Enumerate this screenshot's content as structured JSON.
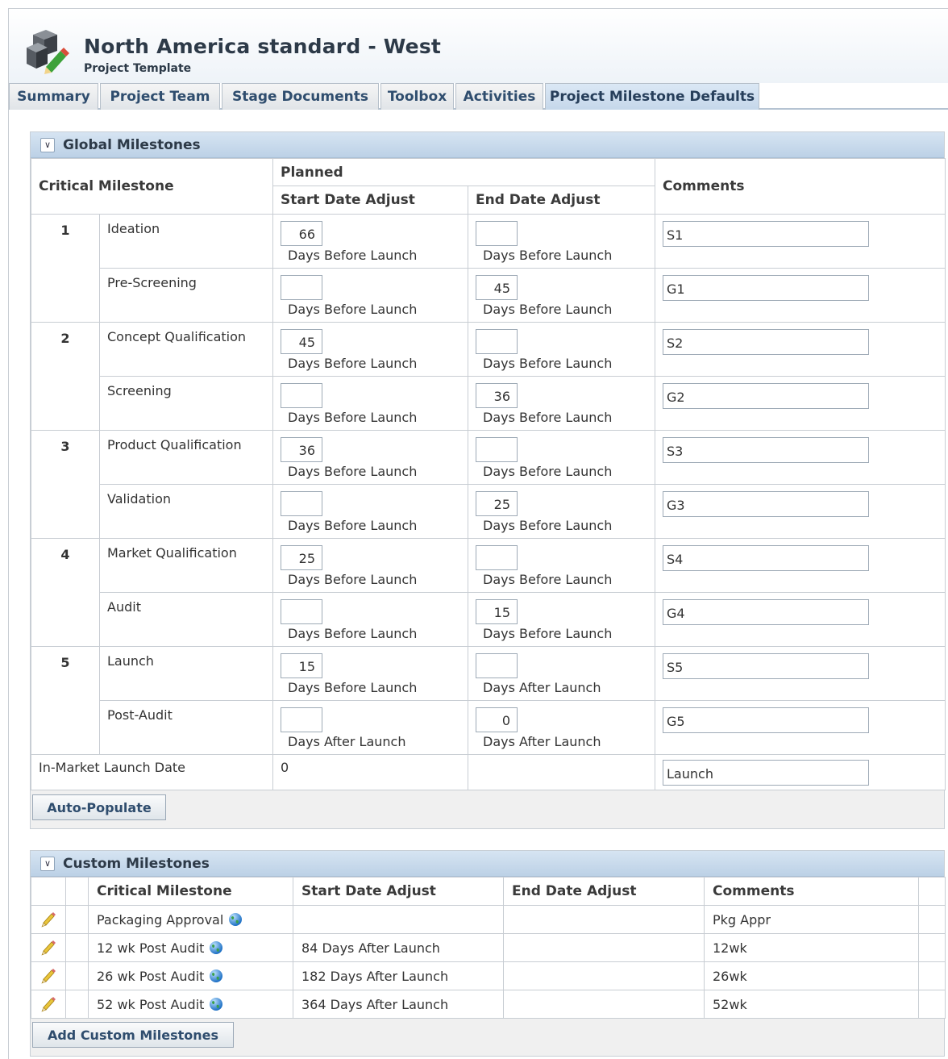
{
  "header": {
    "title": "North America standard - West",
    "subtitle": "Project Template"
  },
  "tabs": [
    {
      "label": "Summary",
      "active": false
    },
    {
      "label": "Project Team",
      "active": false
    },
    {
      "label": "Stage Documents",
      "active": false
    },
    {
      "label": "Toolbox",
      "active": false
    },
    {
      "label": "Activities",
      "active": false
    },
    {
      "label": "Project Milestone Defaults",
      "active": true
    }
  ],
  "global": {
    "title": "Global Milestones",
    "col_critical": "Critical Milestone",
    "col_planned": "Planned",
    "col_start": "Start Date Adjust",
    "col_end": "End Date Adjust",
    "col_comments": "Comments",
    "groups": [
      {
        "num": "1",
        "rows": [
          {
            "name": "Ideation",
            "start": "66",
            "start_unit": "Days Before Launch",
            "end": "",
            "end_unit": "Days Before Launch",
            "comment": "S1"
          },
          {
            "name": "Pre-Screening",
            "start": "",
            "start_unit": "Days Before Launch",
            "end": "45",
            "end_unit": "Days Before Launch",
            "comment": "G1"
          }
        ]
      },
      {
        "num": "2",
        "rows": [
          {
            "name": "Concept Qualification",
            "start": "45",
            "start_unit": "Days Before Launch",
            "end": "",
            "end_unit": "Days Before Launch",
            "comment": "S2"
          },
          {
            "name": "Screening",
            "start": "",
            "start_unit": "Days Before Launch",
            "end": "36",
            "end_unit": "Days Before Launch",
            "comment": "G2"
          }
        ]
      },
      {
        "num": "3",
        "rows": [
          {
            "name": "Product Qualification",
            "start": "36",
            "start_unit": "Days Before Launch",
            "end": "",
            "end_unit": "Days Before Launch",
            "comment": "S3"
          },
          {
            "name": "Validation",
            "start": "",
            "start_unit": "Days Before Launch",
            "end": "25",
            "end_unit": "Days Before Launch",
            "comment": "G3"
          }
        ]
      },
      {
        "num": "4",
        "rows": [
          {
            "name": "Market Qualification",
            "start": "25",
            "start_unit": "Days Before Launch",
            "end": "",
            "end_unit": "Days Before Launch",
            "comment": "S4"
          },
          {
            "name": "Audit",
            "start": "",
            "start_unit": "Days Before Launch",
            "end": "15",
            "end_unit": "Days Before Launch",
            "comment": "G4"
          }
        ]
      },
      {
        "num": "5",
        "rows": [
          {
            "name": "Launch",
            "start": "15",
            "start_unit": "Days Before Launch",
            "end": "",
            "end_unit": "Days After Launch",
            "comment": "S5"
          },
          {
            "name": "Post-Audit",
            "start": "",
            "start_unit": "Days After Launch",
            "end": "0",
            "end_unit": "Days After Launch",
            "comment": "G5"
          }
        ]
      }
    ],
    "launch_row": {
      "label": "In-Market Launch Date",
      "value": "0",
      "comment": "Launch"
    },
    "auto_populate_label": "Auto-Populate"
  },
  "custom": {
    "title": "Custom Milestones",
    "col_critical": "Critical Milestone",
    "col_start": "Start Date Adjust",
    "col_end": "End Date Adjust",
    "col_comments": "Comments",
    "rows": [
      {
        "name": "Packaging Approval",
        "start": "",
        "end": "",
        "comment": "Pkg Appr"
      },
      {
        "name": "12 wk Post Audit",
        "start": "84  Days After Launch",
        "end": "",
        "comment": "12wk"
      },
      {
        "name": "26 wk Post Audit",
        "start": "182  Days After Launch",
        "end": "",
        "comment": "26wk"
      },
      {
        "name": "52 wk Post Audit",
        "start": "364  Days After Launch",
        "end": "",
        "comment": "52wk"
      }
    ],
    "add_label": "Add Custom Milestones"
  },
  "icons": {
    "logo": "project-template-icon",
    "edit": "pencil-icon",
    "global": "globe-icon",
    "collapse": "chevron-down-icon"
  }
}
